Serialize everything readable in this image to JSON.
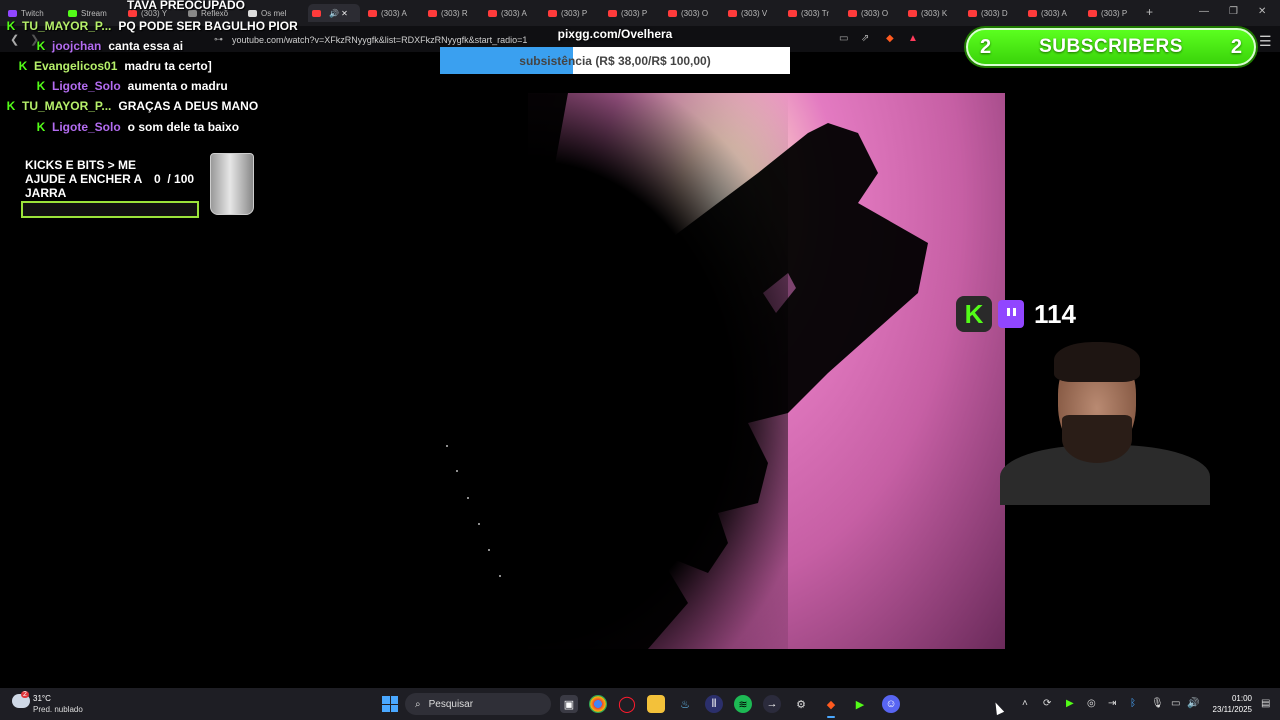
{
  "browser": {
    "tabs": [
      {
        "label": "Twitch",
        "color": "#9146ff"
      },
      {
        "label": "Stream",
        "color": "#53fc18"
      },
      {
        "label": "(303) Y",
        "color": "#ff3b3b"
      },
      {
        "label": "Reflexõ",
        "color": "#888888"
      },
      {
        "label": "Os mel",
        "color": "#dddddd"
      },
      {
        "label": "",
        "color": "#ff3b3b"
      },
      {
        "label": "(303) A",
        "color": "#ff3b3b"
      },
      {
        "label": "(303) R",
        "color": "#ff3b3b"
      },
      {
        "label": "(303) A",
        "color": "#ff3b3b"
      },
      {
        "label": "(303) P",
        "color": "#ff3b3b"
      },
      {
        "label": "(303) P",
        "color": "#ff3b3b"
      },
      {
        "label": "(303) O",
        "color": "#ff3b3b"
      },
      {
        "label": "(303) V",
        "color": "#ff3b3b"
      },
      {
        "label": "(303) Tr",
        "color": "#ff3b3b"
      },
      {
        "label": "(303) O",
        "color": "#ff3b3b"
      },
      {
        "label": "(303) K",
        "color": "#ff3b3b"
      },
      {
        "label": "(303) D",
        "color": "#ff3b3b"
      },
      {
        "label": "(303) A",
        "color": "#ff3b3b"
      },
      {
        "label": "(303) P",
        "color": "#ff3b3b"
      }
    ],
    "url": "youtube.com/watch?v=XFkzRNyygfk&list=RDXFkzRNyygfk&start_radio=1"
  },
  "overlay": {
    "top_banner": "TAVA PREOCUPADO",
    "chat": [
      {
        "user": "TU_MAYOR_P...",
        "message": "PQ PODE SER BAGULHO PIOR",
        "user_color": "#b6f06a"
      },
      {
        "user": "joojchan",
        "message": "canta essa ai",
        "user_color": "#b36cf0"
      },
      {
        "user": "Evangelicos01",
        "message": "madru ta certo]",
        "user_color": "#b6f06a"
      },
      {
        "user": "Ligote_Solo",
        "message": "aumenta o madru",
        "user_color": "#b36cf0"
      },
      {
        "user": "TU_MAYOR_P...",
        "message": "GRAÇAS A DEUS MANO",
        "user_color": "#b6f06a"
      },
      {
        "user": "Ligote_Solo",
        "message": "o som dele ta baixo",
        "user_color": "#b36cf0"
      }
    ],
    "pix": {
      "title": "pixgg.com/Ovelhera",
      "label": "subsistência (R$ 38,00/R$ 100,00)",
      "progress": 0.38
    },
    "subscribers": {
      "count": "2",
      "label": "SUBSCRIBERS"
    },
    "goal": {
      "text": "KICKS E BITS > ME AJUDE A ENCHER A JARRA",
      "count": "0",
      "total": "/ 100",
      "progress": 0
    },
    "viewers": "114",
    "kick_glyph": "K"
  },
  "taskbar": {
    "weather_temp": "31°C",
    "weather_desc": "Pred. nublado",
    "search_placeholder": "Pesquisar",
    "time": "01:00",
    "date": "23/11/2025",
    "notification_badge": "2"
  }
}
